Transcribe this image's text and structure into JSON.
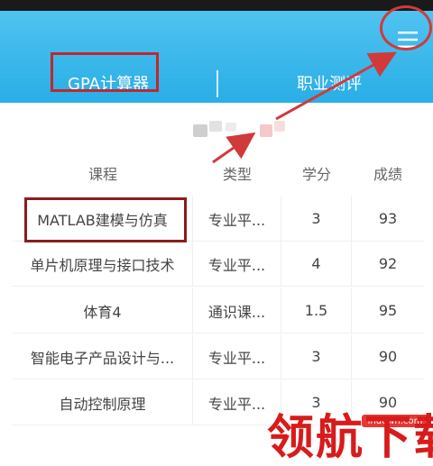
{
  "header": {
    "menu_icon": "hamburger-menu-icon",
    "tabs": [
      {
        "label": "GPA计算器"
      },
      {
        "label": "职业测评"
      }
    ]
  },
  "table": {
    "headers": [
      "课程",
      "类型",
      "学分",
      "成绩"
    ],
    "rows": [
      {
        "course": "MATLAB建模与仿真",
        "type": "专业平...",
        "credit": "3",
        "grade": "93"
      },
      {
        "course": "单片机原理与接口技术",
        "type": "专业平...",
        "credit": "4",
        "grade": "92"
      },
      {
        "course": "体育4",
        "type": "通识课...",
        "credit": "1.5",
        "grade": "95"
      },
      {
        "course": "智能电子产品设计与...",
        "type": "专业平...",
        "credit": "3",
        "grade": "90"
      },
      {
        "course": "自动控制原理",
        "type": "专业平...",
        "credit": "3",
        "grade": "90"
      }
    ]
  },
  "watermark": {
    "url": "lhdown.com",
    "text": "领航下载"
  },
  "colors": {
    "header_blue": "#29aee6",
    "annotation_red": "#c0282d"
  }
}
